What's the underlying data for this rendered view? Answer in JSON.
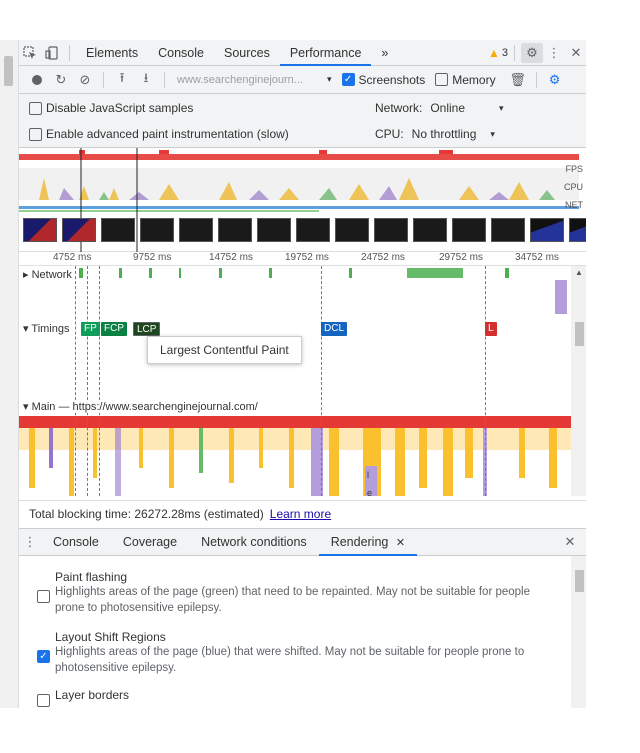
{
  "tabs": [
    "Elements",
    "Console",
    "Sources",
    "Performance"
  ],
  "active_tab": "Performance",
  "more_tabs": "»",
  "warnings_count": "3",
  "toolbar": {
    "url": "www.searchenginejourn...",
    "screenshots_label": "Screenshots",
    "memory_label": "Memory"
  },
  "settings": {
    "disable_js_samples": "Disable JavaScript samples",
    "advanced_paint": "Enable advanced paint instrumentation (slow)",
    "network_label": "Network:",
    "network_value": "Online",
    "cpu_label": "CPU:",
    "cpu_value": "No throttling"
  },
  "overview_labels": {
    "fps": "FPS",
    "cpu": "CPU",
    "net": "NET"
  },
  "ruler_ticks": [
    "4752 ms",
    "9752 ms",
    "14752 ms",
    "19752 ms",
    "24752 ms",
    "29752 ms",
    "34752 ms"
  ],
  "tracks": {
    "network": "Network",
    "timings": "Timings",
    "main": "Main — https://www.searchenginejournal.com/"
  },
  "timing_marks": {
    "fp": "FP",
    "fcp": "FCP",
    "lcp": "LCP",
    "dcl": "DCL",
    "l": "L"
  },
  "tooltip": "Largest Contentful Paint",
  "summary": {
    "text": "Total blocking time: 26272.28ms (estimated)",
    "link": "Learn more"
  },
  "drawer_tabs": [
    "Console",
    "Coverage",
    "Network conditions",
    "Rendering"
  ],
  "rendering": {
    "paint_flashing_title": "Paint flashing",
    "paint_flashing_desc": "Highlights areas of the page (green) that need to be repainted. May not be suitable for people prone to photosensitive epilepsy.",
    "layout_shift_title": "Layout Shift Regions",
    "layout_shift_desc": "Highlights areas of the page (blue) that were shifted. May not be suitable for people prone to photosensitive epilepsy.",
    "layer_borders_title": "Layer borders"
  }
}
